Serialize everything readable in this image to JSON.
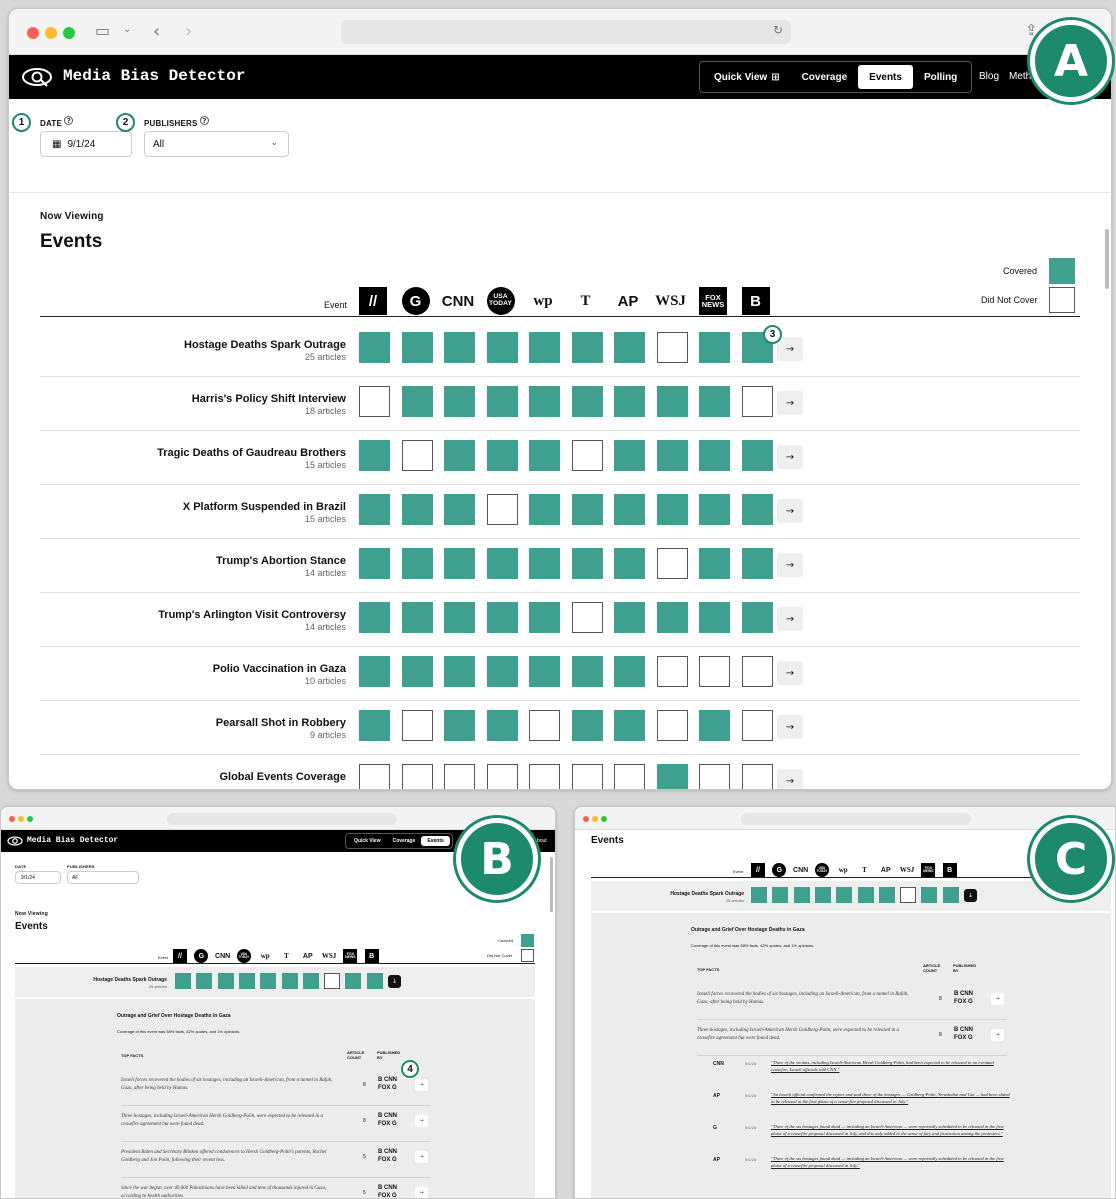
{
  "app": {
    "brand": "Media Bias Detector",
    "nav": [
      "Quick View",
      "Coverage",
      "Events",
      "Polling"
    ],
    "nav_active": "Events",
    "links": [
      "Blog",
      "Metho"
    ],
    "small_links": [
      "bout"
    ]
  },
  "filters": {
    "date_label": "DATE",
    "date_value": "9/1/24",
    "publishers_label": "PUBLISHERS",
    "publishers_value": "All",
    "help": "?"
  },
  "heading": {
    "kicker": "Now Viewing",
    "title": "Events"
  },
  "legend": {
    "covered": "Covered",
    "not_covered": "Did Not Cover"
  },
  "table": {
    "event_header": "Event",
    "publishers": [
      "Breitbart-like slash logo",
      "Guardian G",
      "CNN",
      "USA TODAY",
      "wp",
      "NYT T",
      "AP",
      "WSJ",
      "FOX NEWS channel",
      "Breitbart B"
    ],
    "publisher_marks": [
      "//",
      "G",
      "CNN",
      "USA TODAY",
      "wp",
      "T",
      "AP",
      "WSJ",
      "FOX NEWS",
      "B"
    ],
    "rows": [
      {
        "title": "Hostage Deaths Spark Outrage",
        "sub": "25 articles",
        "cov": [
          1,
          1,
          1,
          1,
          1,
          1,
          1,
          0,
          1,
          1
        ]
      },
      {
        "title": "Harris's Policy Shift Interview",
        "sub": "18 articles",
        "cov": [
          0,
          1,
          1,
          1,
          1,
          1,
          1,
          1,
          1,
          0
        ]
      },
      {
        "title": "Tragic Deaths of Gaudreau Brothers",
        "sub": "15 articles",
        "cov": [
          1,
          0,
          1,
          1,
          1,
          0,
          1,
          1,
          1,
          1
        ]
      },
      {
        "title": "X Platform Suspended in Brazil",
        "sub": "15 articles",
        "cov": [
          1,
          1,
          1,
          0,
          1,
          1,
          1,
          1,
          1,
          1
        ]
      },
      {
        "title": "Trump's Abortion Stance",
        "sub": "14 articles",
        "cov": [
          1,
          1,
          1,
          1,
          1,
          1,
          1,
          0,
          1,
          1
        ]
      },
      {
        "title": "Trump's Arlington Visit Controversy",
        "sub": "14 articles",
        "cov": [
          1,
          1,
          1,
          1,
          1,
          0,
          1,
          1,
          1,
          1
        ]
      },
      {
        "title": "Polio Vaccination in Gaza",
        "sub": "10 articles",
        "cov": [
          1,
          1,
          1,
          1,
          1,
          1,
          1,
          0,
          0,
          0
        ]
      },
      {
        "title": "Pearsall Shot in Robbery",
        "sub": "9 articles",
        "cov": [
          1,
          0,
          1,
          1,
          0,
          1,
          1,
          0,
          1,
          0
        ]
      },
      {
        "title": "Global Events Coverage",
        "sub": "",
        "cov": [
          0,
          0,
          0,
          0,
          0,
          0,
          0,
          1,
          0,
          0
        ]
      }
    ],
    "arrow": "→"
  },
  "badges": {
    "A": "A",
    "B": "B",
    "C": "C",
    "n1": "1",
    "n2": "2",
    "n3": "3",
    "n4": "4"
  },
  "detail": {
    "event_title": "Hostage Deaths Spark Outrage",
    "event_sub": "25 articles",
    "heading": "Outrage and Grief Over Hostage Deaths in Gaza",
    "coverage_line": "Coverage of this event was 58% facts, 42% quotes, and 1% opinions.",
    "top_facts": "TOP FACTS",
    "article_count": "ARTICLE COUNT",
    "published_by": "PUBLISHED BY",
    "facts": [
      {
        "text": "Israeli forces recovered the bodies of six hostages, including an Israeli-American, from a tunnel in Rafah, Gaza, after being held by Hamas.",
        "count": "8"
      },
      {
        "text": "Three hostages, including Israeli-American Hersh Goldberg-Polin, were expected to be released in a ceasefire agreement but were found dead.",
        "count": "8"
      },
      {
        "text": "President Biden and Secretary Blinken offered condolences to Hersh Goldberg-Polin's parents, Rachel Goldberg and Jon Polin, following their recent loss.",
        "count": "5"
      },
      {
        "text": "Since the war began, over 40,000 Palestinians have been killed and tens of thousands injured in Gaza, according to health authorities.",
        "count": "5"
      }
    ],
    "quotes": [
      {
        "pub": "CNN",
        "date": "9/1/24",
        "text": "\"Three of the victims, including Israeli-American Hersh Goldberg-Polin, had been expected to be released in an eventual ceasefire, Israeli officials told CNN.\""
      },
      {
        "pub": "AP",
        "date": "9/1/24",
        "text": "\"An Israeli official confirmed the report and said three of the hostages — Goldberg-Polin, Yerushalmi and Gat — had been slated to be released in the first phase of a cease-fire proposal discussed in July.\""
      },
      {
        "pub": "G",
        "date": "9/1/24",
        "text": "\"Three of the six hostages found dead — including an Israeli-American — were reportedly scheduled to be released in the first phase of a ceasefire proposal discussed in July, and this only added to the sense of fury and frustration among the protesters.\""
      },
      {
        "pub": "AP",
        "date": "9/1/24",
        "text": "\"Three of the six hostages found dead — including an Israeli-American — were reportedly scheduled to be released in the first phase of a ceasefire proposal discussed in July.\""
      }
    ]
  },
  "colors": {
    "covered": "#3fa08f",
    "badge": "#1d8a6e",
    "nav_bg": "#000000"
  }
}
